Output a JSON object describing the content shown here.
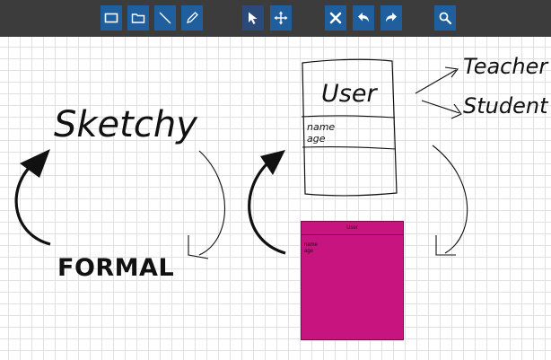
{
  "toolbar": {
    "tools": [
      {
        "name": "rectangle-tool",
        "icon": "rectangle-icon"
      },
      {
        "name": "folder-tool",
        "icon": "folder-icon"
      },
      {
        "name": "line-tool",
        "icon": "line-icon"
      },
      {
        "name": "pencil-tool",
        "icon": "pencil-icon"
      },
      {
        "name": "select-tool",
        "icon": "cursor-arrow-icon",
        "active": true
      },
      {
        "name": "move-tool",
        "icon": "move-arrows-icon"
      },
      {
        "name": "delete-tool",
        "icon": "close-x-icon"
      },
      {
        "name": "undo-tool",
        "icon": "undo-arrow-icon"
      },
      {
        "name": "redo-tool",
        "icon": "redo-arrow-icon"
      },
      {
        "name": "search-tool",
        "icon": "magnifier-icon"
      }
    ],
    "colors": {
      "bar": "#3c3c3c",
      "button": "#1f5f9e",
      "active": "#2c4a79"
    }
  },
  "canvas": {
    "sketchy_label": "Sketchy",
    "formal_label": "FORMAL",
    "sketch_class": {
      "title": "User",
      "attributes": [
        "name",
        "age"
      ],
      "relations": [
        "Teacher",
        "Student"
      ]
    },
    "formal_class": {
      "title": "User",
      "attributes": [
        "name",
        "age"
      ],
      "fill_color": "#c8147e"
    }
  }
}
